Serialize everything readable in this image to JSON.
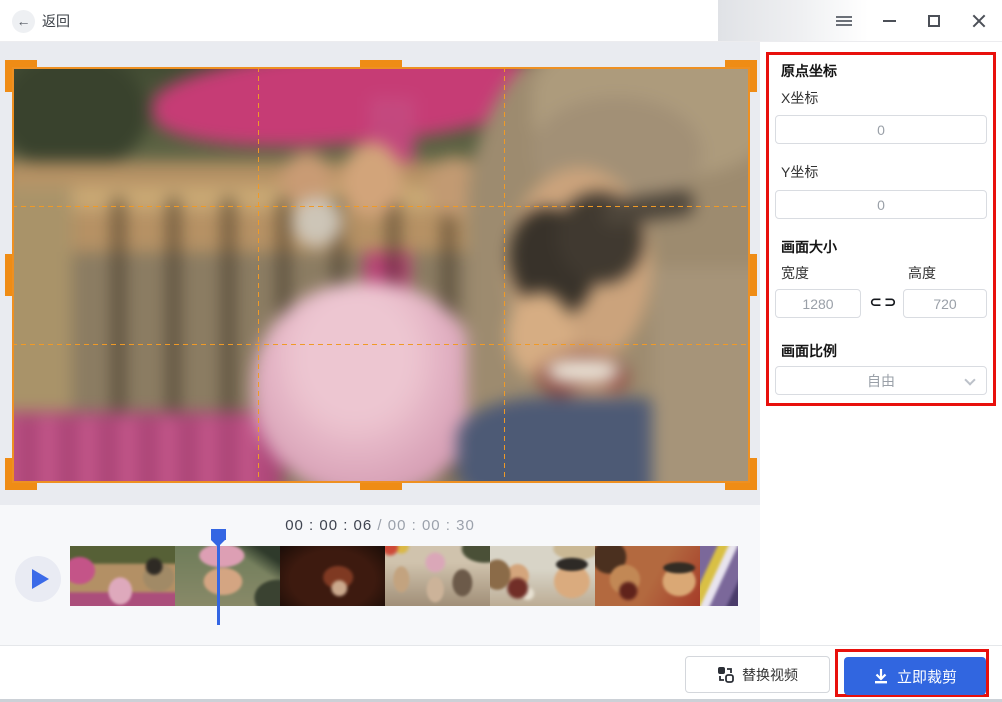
{
  "titlebar": {
    "back_label": "返回"
  },
  "panel": {
    "origin_title": "原点坐标",
    "x_label": "X坐标",
    "x_value": "0",
    "y_label": "Y坐标",
    "y_value": "0",
    "size_title": "画面大小",
    "width_label": "宽度",
    "width_value": "1280",
    "height_label": "高度",
    "height_value": "720",
    "ratio_title": "画面比例",
    "ratio_value": "自由"
  },
  "timeline": {
    "current_time": "00 : 00 : 06",
    "total_time": " / 00 : 00 : 30",
    "thumbnail_count": 7
  },
  "footer": {
    "replace_label": "替换视频",
    "crop_label": "立即裁剪"
  },
  "icons": {
    "back_glyph": "←",
    "link_left_glyph": "⊂",
    "link_right_glyph": "⊃"
  },
  "colors": {
    "crop_accent": "#EF8C15",
    "primary_blue": "#3166E0",
    "annotation_red": "#E8100C",
    "playhead_blue": "#3466E3"
  }
}
